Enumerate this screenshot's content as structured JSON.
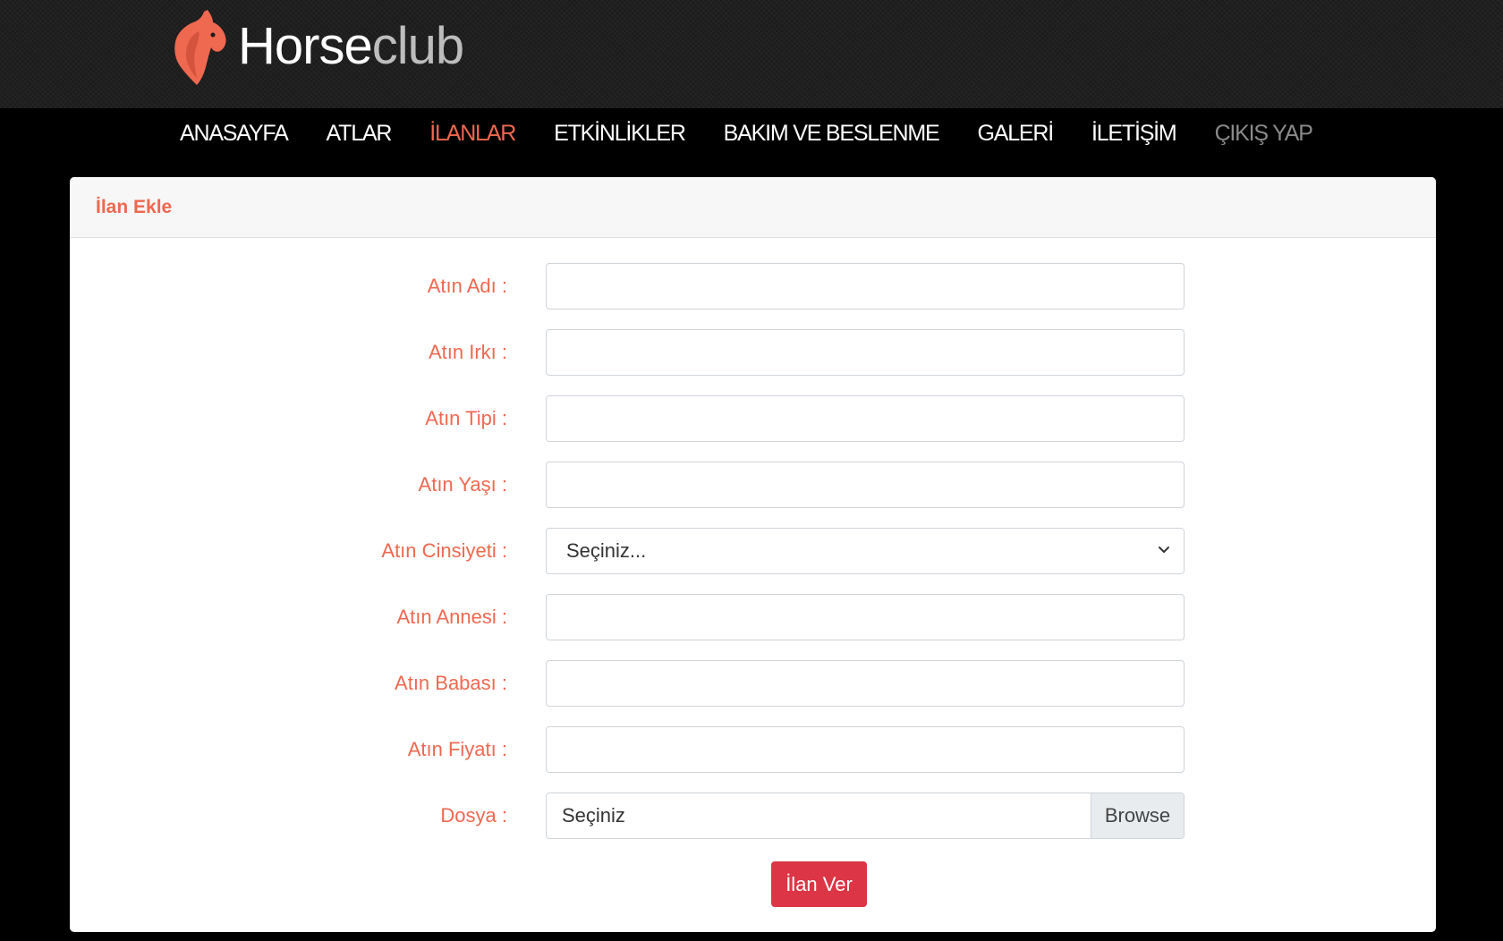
{
  "brand": {
    "name_primary": "Horse",
    "name_secondary": "club",
    "accent": "#ef6850"
  },
  "nav": {
    "items": [
      {
        "label": "ANASAYFA"
      },
      {
        "label": "ATLAR"
      },
      {
        "label": "İLANLAR",
        "active": true
      },
      {
        "label": "ETKİNLİKLER"
      },
      {
        "label": "BAKIM VE BESLENME"
      },
      {
        "label": "GALERİ"
      },
      {
        "label": "İLETİŞİM"
      },
      {
        "label": "ÇIKIŞ YAP"
      }
    ]
  },
  "card": {
    "title": "İlan Ekle"
  },
  "form": {
    "horse_name": {
      "label": "Atın Adı :",
      "value": ""
    },
    "horse_breed": {
      "label": "Atın Irkı :",
      "value": ""
    },
    "horse_type": {
      "label": "Atın Tipi :",
      "value": ""
    },
    "horse_age": {
      "label": "Atın Yaşı :",
      "value": ""
    },
    "horse_gender": {
      "label": "Atın Cinsiyeti :",
      "selected": "Seçiniz..."
    },
    "horse_mother": {
      "label": "Atın Annesi :",
      "value": ""
    },
    "horse_father": {
      "label": "Atın Babası :",
      "value": ""
    },
    "horse_price": {
      "label": "Atın Fiyatı :",
      "value": ""
    },
    "file": {
      "label": "Dosya :",
      "placeholder": "Seçiniz",
      "browse_label": "Browse"
    },
    "submit_label": "İlan Ver"
  },
  "icons": {
    "logo": "horse-head-icon",
    "select_arrow": "chevron-down-icon"
  },
  "colors": {
    "header_bg": "#1b1b1b",
    "nav_bg": "#000000",
    "label": "#ef6850",
    "submit_bg": "#dc3545"
  }
}
